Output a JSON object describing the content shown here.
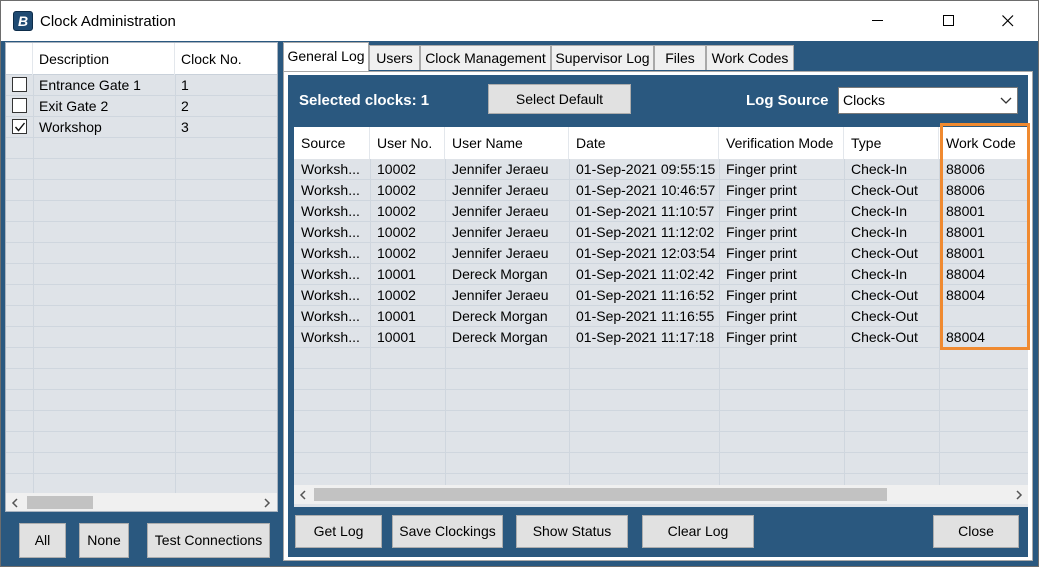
{
  "window": {
    "title": "Clock Administration",
    "app_icon": "app-logo-icon"
  },
  "clocks": {
    "columns": [
      "Description",
      "Clock No."
    ],
    "rows": [
      {
        "checked": false,
        "description": "Entrance Gate 1",
        "clock_no": "1"
      },
      {
        "checked": false,
        "description": "Exit Gate 2",
        "clock_no": "2"
      },
      {
        "checked": true,
        "description": "Workshop",
        "clock_no": "3"
      }
    ]
  },
  "left_buttons": {
    "all": "All",
    "none": "None",
    "test": "Test Connections"
  },
  "tabs": [
    "General Log",
    "Users",
    "Clock Management",
    "Supervisor Log",
    "Files",
    "Work Codes"
  ],
  "active_tab": "General Log",
  "toolbar": {
    "selected_clocks": "Selected clocks: 1",
    "select_default": "Select Default",
    "log_source_label": "Log Source",
    "log_source_value": "Clocks"
  },
  "log": {
    "columns": [
      "Source",
      "User No.",
      "User Name",
      "Date",
      "Verification Mode",
      "Type",
      "Work Code"
    ],
    "rows": [
      [
        "Worksh...",
        "10002",
        "Jennifer Jeraeu",
        "01-Sep-2021 09:55:15",
        "Finger print",
        "Check-In",
        "88006"
      ],
      [
        "Worksh...",
        "10002",
        "Jennifer Jeraeu",
        "01-Sep-2021 10:46:57",
        "Finger print",
        "Check-Out",
        "88006"
      ],
      [
        "Worksh...",
        "10002",
        "Jennifer Jeraeu",
        "01-Sep-2021 11:10:57",
        "Finger print",
        "Check-In",
        "88001"
      ],
      [
        "Worksh...",
        "10002",
        "Jennifer Jeraeu",
        "01-Sep-2021 11:12:02",
        "Finger print",
        "Check-In",
        "88001"
      ],
      [
        "Worksh...",
        "10002",
        "Jennifer Jeraeu",
        "01-Sep-2021 12:03:54",
        "Finger print",
        "Check-Out",
        "88001"
      ],
      [
        "Worksh...",
        "10001",
        "Dereck Morgan",
        "01-Sep-2021 11:02:42",
        "Finger print",
        "Check-In",
        "88004"
      ],
      [
        "Worksh...",
        "10002",
        "Jennifer Jeraeu",
        "01-Sep-2021 11:16:52",
        "Finger print",
        "Check-Out",
        "88004"
      ],
      [
        "Worksh...",
        "10001",
        "Dereck Morgan",
        "01-Sep-2021 11:16:55",
        "Finger print",
        "Check-Out",
        ""
      ],
      [
        "Worksh...",
        "10001",
        "Dereck Morgan",
        "01-Sep-2021 11:17:18",
        "Finger print",
        "Check-Out",
        "88004"
      ]
    ]
  },
  "bottom_buttons": {
    "get_log": "Get Log",
    "save_clockings": "Save Clockings",
    "show_status": "Show Status",
    "clear_log": "Clear Log",
    "close": "Close"
  },
  "colors": {
    "panel": "#2a587f",
    "highlight": "#f08a30",
    "grid": "#dfe3e8"
  }
}
